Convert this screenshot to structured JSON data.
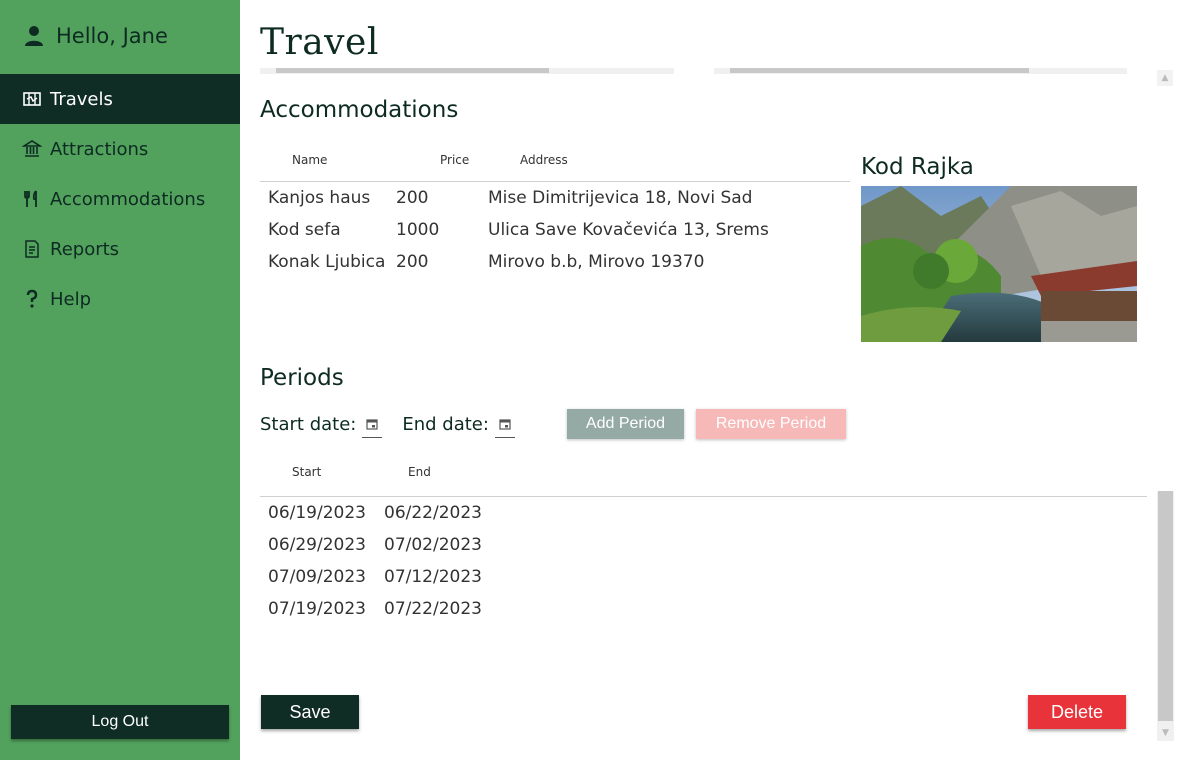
{
  "sidebar": {
    "greeting": "Hello, Jane",
    "items": [
      {
        "label": "Travels",
        "icon": "map-icon",
        "active": true
      },
      {
        "label": "Attractions",
        "icon": "bank-icon"
      },
      {
        "label": "Accommodations",
        "icon": "utensils-icon"
      },
      {
        "label": "Reports",
        "icon": "report-icon"
      },
      {
        "label": "Help",
        "icon": "question-icon"
      }
    ],
    "logout_label": "Log Out"
  },
  "page": {
    "title": "Travel"
  },
  "accommodations": {
    "title": "Accommodations",
    "columns": [
      "Name",
      "Price",
      "Address"
    ],
    "rows": [
      [
        "Kanjos haus",
        "200",
        "Mise Dimitrijevica 18, Novi Sad"
      ],
      [
        "Kod sefa",
        "1000",
        "Ulica Save Kovačevića 13, Srems"
      ],
      [
        "Konak Ljubica",
        "200",
        "Mirovo b.b, Mirovo 19370"
      ]
    ],
    "selected_name": "Kod Rajka"
  },
  "periods": {
    "title": "Periods",
    "start_label": "Start date:",
    "end_label": "End date:",
    "add_label": "Add Period",
    "remove_label": "Remove Period",
    "columns": [
      "Start",
      "End"
    ],
    "rows": [
      [
        "06/19/2023",
        "06/22/2023"
      ],
      [
        "06/29/2023",
        "07/02/2023"
      ],
      [
        "07/09/2023",
        "07/12/2023"
      ],
      [
        "07/19/2023",
        "07/22/2023"
      ]
    ]
  },
  "actions": {
    "save_label": "Save",
    "delete_label": "Delete"
  },
  "colors": {
    "sidebar_bg": "#52a25d",
    "dark": "#0f2d25",
    "delete": "#e8333a",
    "add_disabled": "#95aaa5",
    "remove_disabled": "#f7b8b8"
  }
}
